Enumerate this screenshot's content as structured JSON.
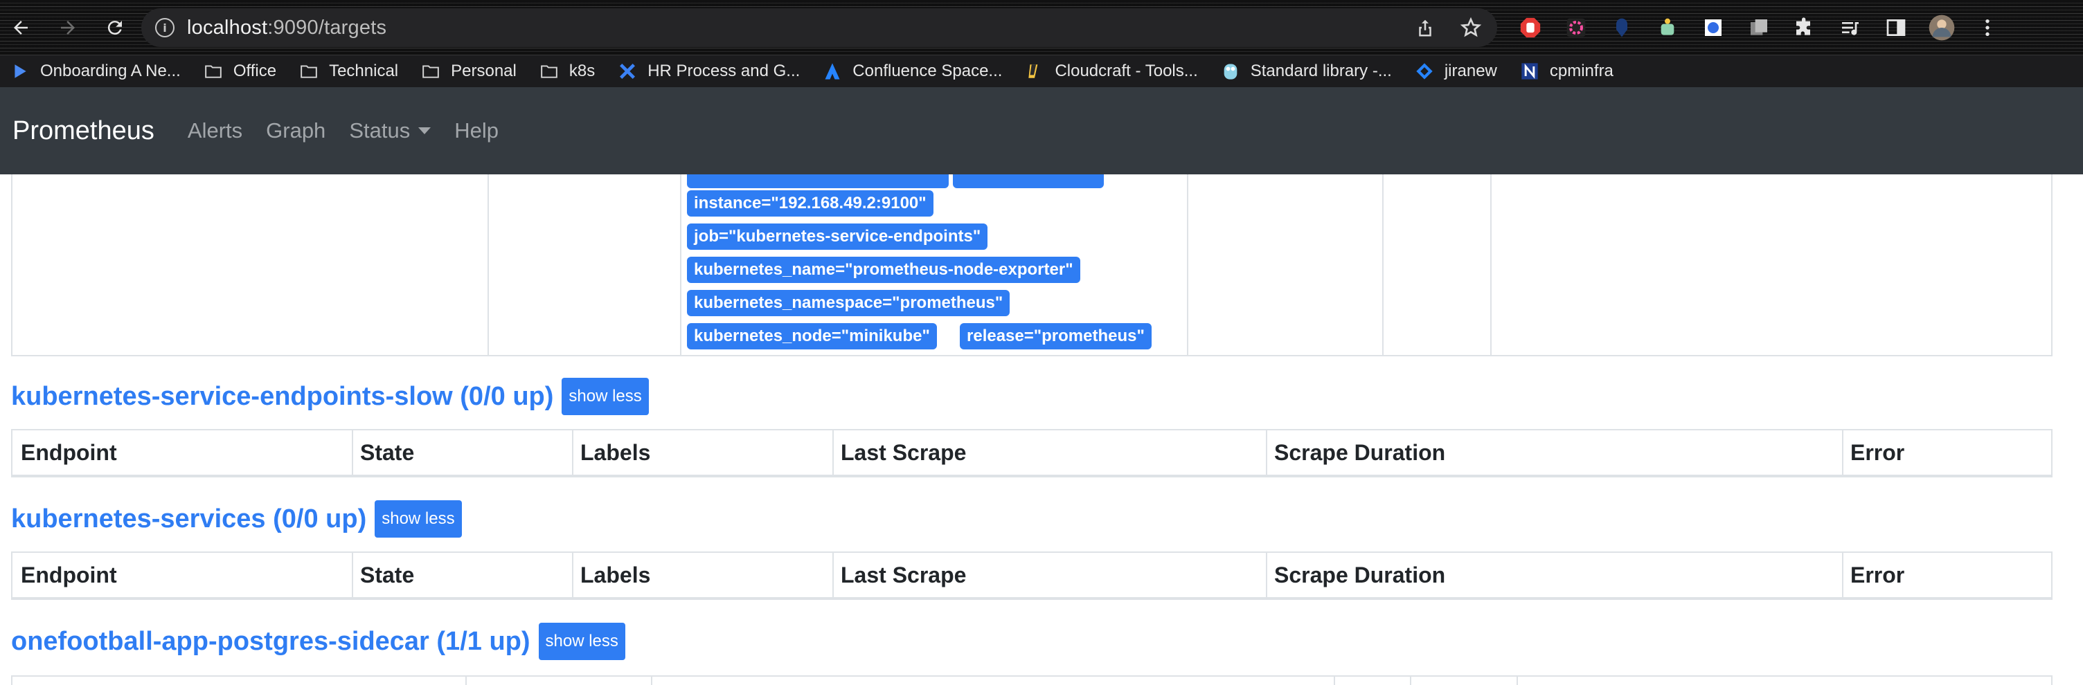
{
  "browser": {
    "url_host": "localhost",
    "url_path": ":9090/targets",
    "bookmarks": [
      {
        "label": "Onboarding A Ne...",
        "icon": "play-icon"
      },
      {
        "label": "Office",
        "icon": "folder-icon"
      },
      {
        "label": "Technical",
        "icon": "folder-icon"
      },
      {
        "label": "Personal",
        "icon": "folder-icon"
      },
      {
        "label": "k8s",
        "icon": "folder-icon"
      },
      {
        "label": "HR Process and G...",
        "icon": "confluence-x-icon"
      },
      {
        "label": "Confluence Space...",
        "icon": "atlassian-icon"
      },
      {
        "label": "Cloudcraft - Tools...",
        "icon": "cloudcraft-icon"
      },
      {
        "label": "Standard library -...",
        "icon": "go-gopher-icon"
      },
      {
        "label": "jiranew",
        "icon": "jira-icon"
      },
      {
        "label": "cpminfra",
        "icon": "n-logo-icon"
      }
    ]
  },
  "navbar": {
    "brand": "Prometheus",
    "links": [
      "Alerts",
      "Graph",
      "Status",
      "Help"
    ]
  },
  "top_table": {
    "labels": [
      "instance=\"192.168.49.2:9100\"",
      "job=\"kubernetes-service-endpoints\"",
      "kubernetes_name=\"prometheus-node-exporter\"",
      "kubernetes_namespace=\"prometheus\"",
      "kubernetes_node=\"minikube\"",
      "release=\"prometheus\""
    ]
  },
  "sections": [
    {
      "title": "kubernetes-service-endpoints-slow (0/0 up)",
      "button": "show less"
    },
    {
      "title": "kubernetes-services (0/0 up)",
      "button": "show less"
    },
    {
      "title": "onefootball-app-postgres-sidecar (1/1 up)",
      "button": "show less"
    }
  ],
  "table_headers": [
    "Endpoint",
    "State",
    "Labels",
    "Last Scrape",
    "Scrape Duration",
    "Error"
  ],
  "colors": {
    "accent": "#2f7df3",
    "navbar": "#343a40",
    "border": "#dee2e6"
  }
}
